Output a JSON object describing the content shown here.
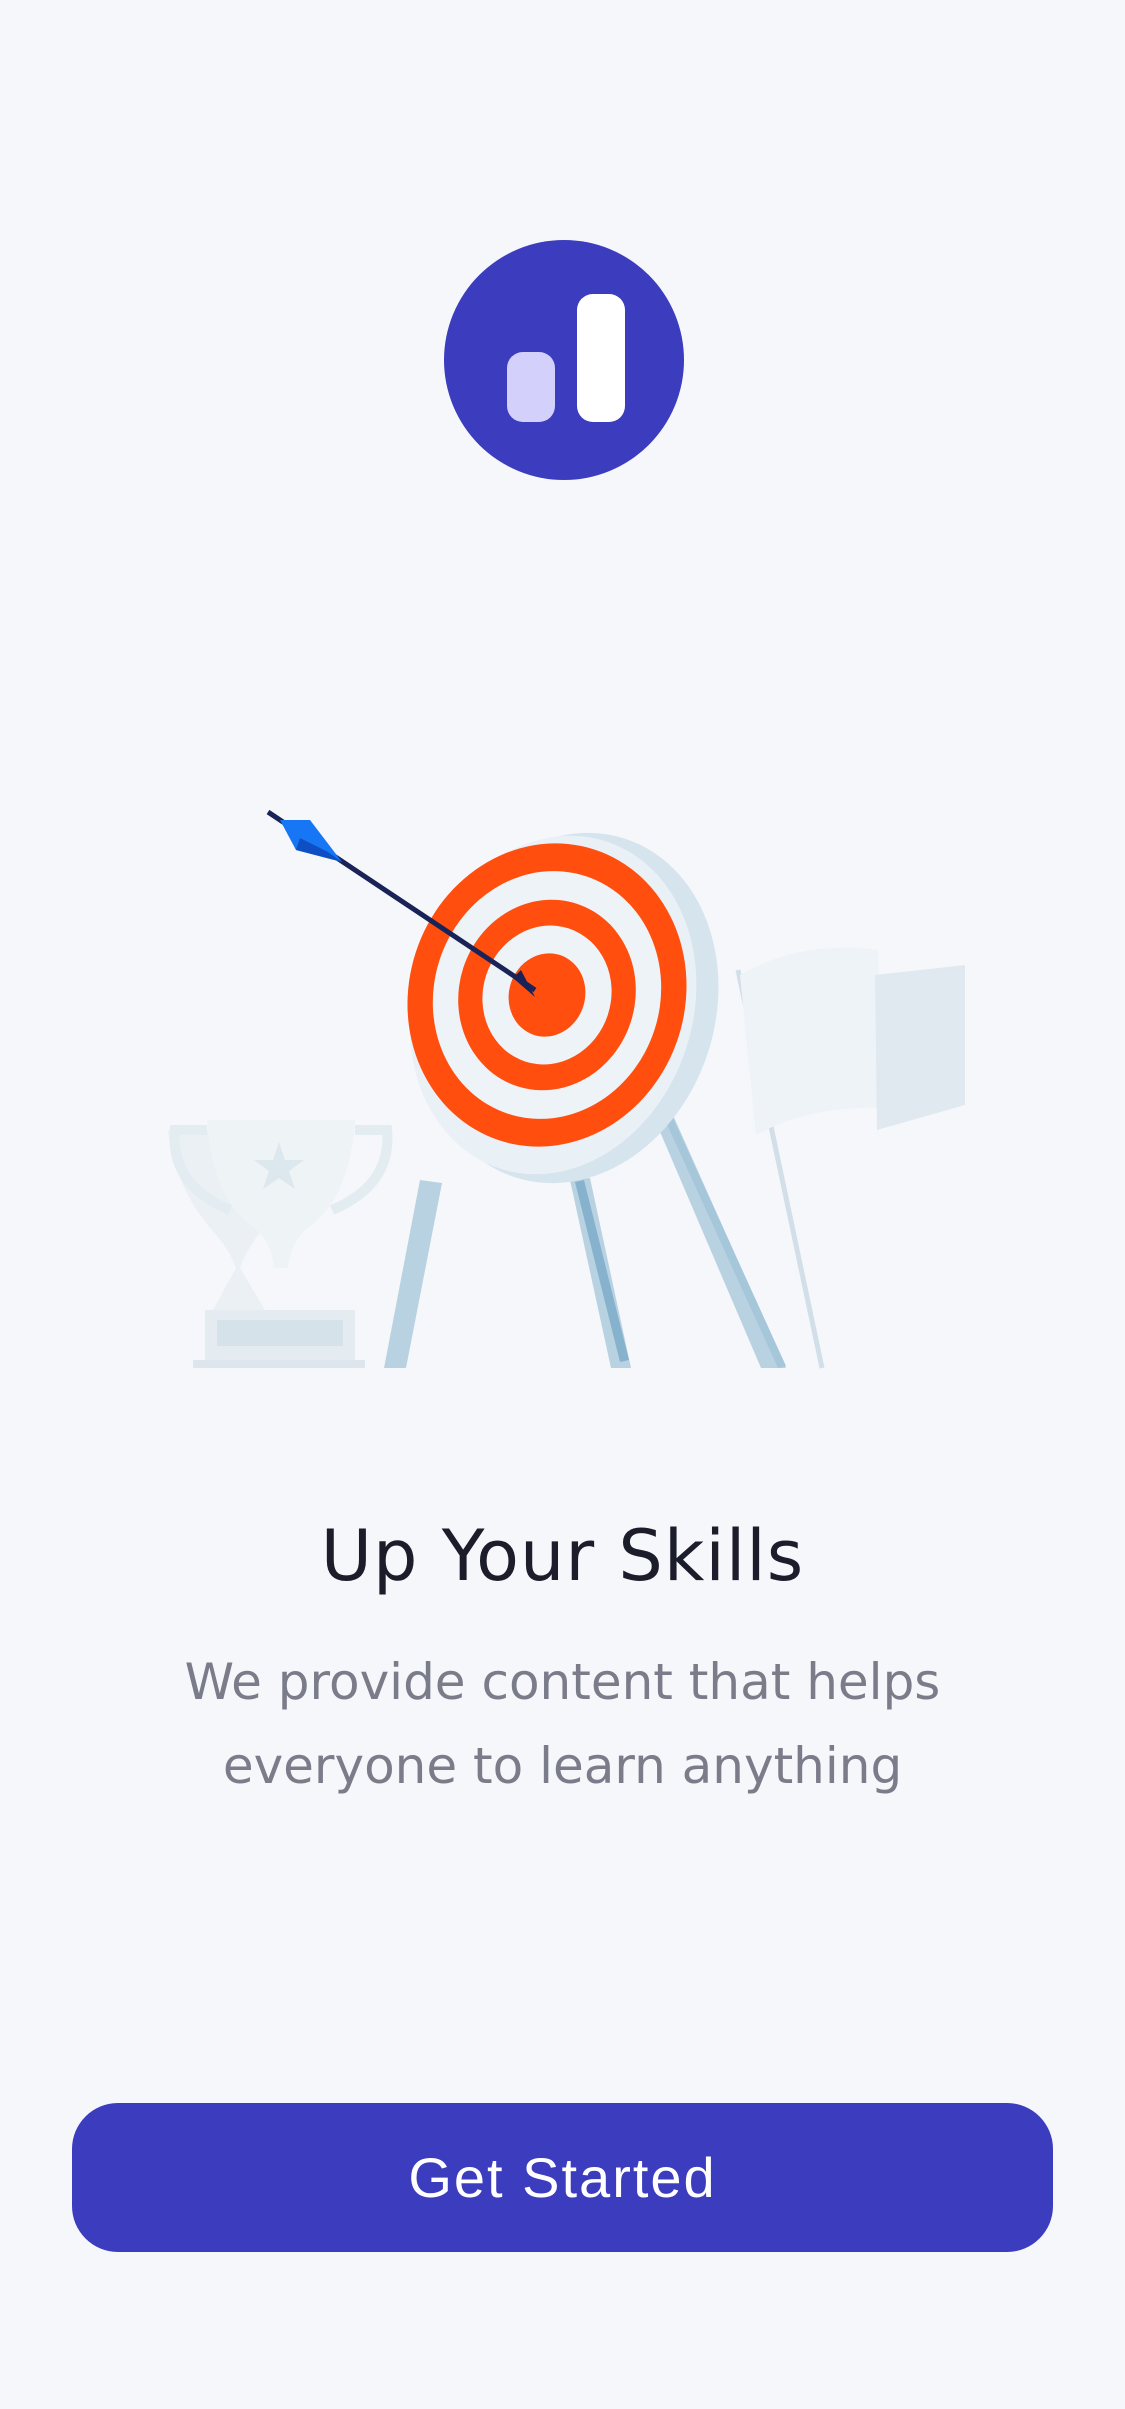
{
  "onboarding": {
    "title": "Up Your Skills",
    "subtitle": "We provide content that helps everyone to learn anything",
    "cta_label": "Get Started"
  },
  "illustration": {
    "elements": [
      "trophy-icon",
      "target-icon",
      "arrow-icon",
      "flag-icon"
    ]
  },
  "colors": {
    "brand": "#3C3CBE",
    "brand_light": "#D3D0FB",
    "background": "#F5F7FB",
    "target_orange": "#FF4E0E",
    "arrow_blue": "#1676F3",
    "title_text": "#1B1D2A",
    "subtitle_text": "#7A7C8A"
  }
}
